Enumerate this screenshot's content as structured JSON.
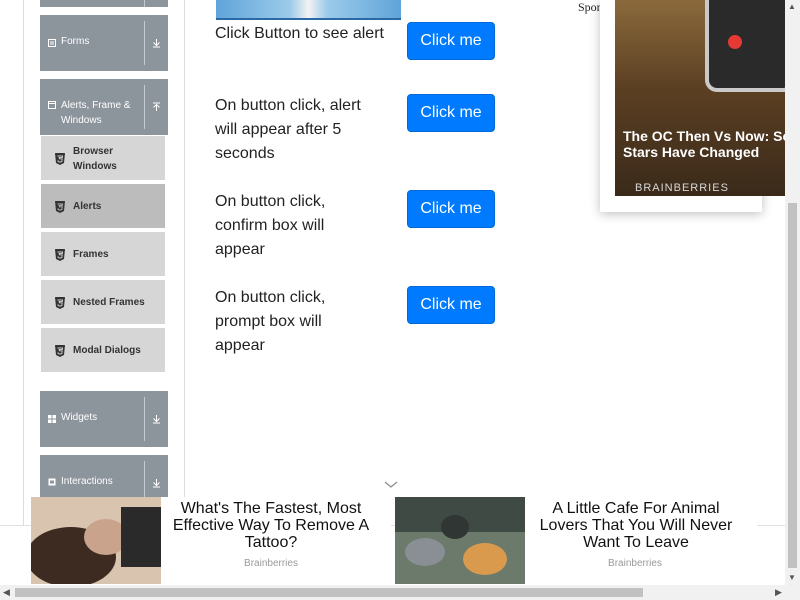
{
  "sidebar": {
    "groups": [
      {
        "label": "Forms",
        "icon": "form-icon"
      },
      {
        "label": "Alerts, Frame & Windows",
        "icon": "window-icon"
      },
      {
        "label": "Widgets",
        "icon": "widgets-icon"
      },
      {
        "label": "Interactions",
        "icon": "interactions-icon"
      }
    ],
    "subitems": [
      {
        "label": "Browser Windows"
      },
      {
        "label": "Alerts"
      },
      {
        "label": "Frames"
      },
      {
        "label": "Nested Frames"
      },
      {
        "label": "Modal Dialogs"
      }
    ],
    "active_item": "Alerts"
  },
  "main": {
    "rows": [
      {
        "text": "Click Button to see alert",
        "button": "Click me"
      },
      {
        "text": "On button click, alert will appear after 5 seconds",
        "button": "Click me"
      },
      {
        "text": "On button click, confirm box will appear",
        "button": "Click me"
      },
      {
        "text": "On button click, prompt box will appear",
        "button": "Click me"
      }
    ]
  },
  "right_ad": {
    "sponsor_label": "Spon",
    "headline": "The OC Then Vs Now: So Stars Have Changed",
    "brand": "BRAINBERRIES"
  },
  "bottom_ads": [
    {
      "title": "What's The Fastest, Most Effective Way To Remove A Tattoo?",
      "source": "Brainberries"
    },
    {
      "title": "A Little Cafe For Animal Lovers That You Will Never Want To Leave",
      "source": "Brainberries"
    }
  ],
  "colors": {
    "primary_button": "#007bff",
    "group_header": "#8c949c",
    "subitem": "#d6d6d6",
    "subitem_active": "#bcbcbc"
  }
}
